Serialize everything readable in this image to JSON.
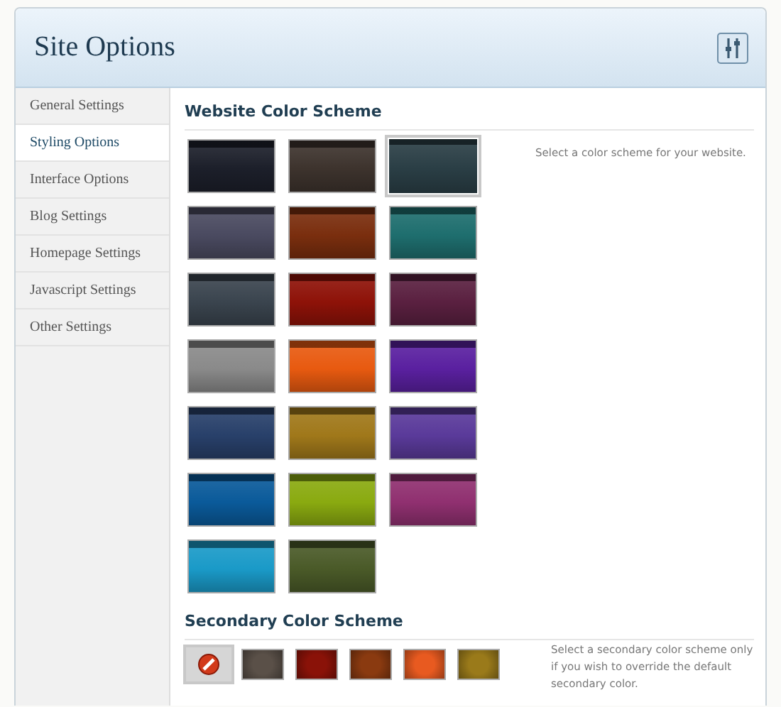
{
  "header": {
    "title": "Site Options"
  },
  "sidebar": {
    "items": [
      {
        "label": "General Settings",
        "selected": false
      },
      {
        "label": "Styling Options",
        "selected": true
      },
      {
        "label": "Interface Options",
        "selected": false
      },
      {
        "label": "Blog Settings",
        "selected": false
      },
      {
        "label": "Homepage Settings",
        "selected": false
      },
      {
        "label": "Javascript Settings",
        "selected": false
      },
      {
        "label": "Other Settings",
        "selected": false
      }
    ]
  },
  "website_color_scheme": {
    "heading": "Website Color Scheme",
    "description": "Select a color scheme for your website.",
    "swatches": [
      {
        "color": "#1c1f2a",
        "selected": false
      },
      {
        "color": "#3d332d",
        "selected": false
      },
      {
        "color": "#2a3e45",
        "selected": true
      },
      {
        "color": "#4a4a60",
        "selected": false
      },
      {
        "color": "#7a2e0e",
        "selected": false
      },
      {
        "color": "#1e6e6e",
        "selected": false
      },
      {
        "color": "#3a444e",
        "selected": false
      },
      {
        "color": "#8e1208",
        "selected": false
      },
      {
        "color": "#5a2040",
        "selected": false
      },
      {
        "color": "#8a8a8a",
        "selected": false
      },
      {
        "color": "#e85a10",
        "selected": false
      },
      {
        "color": "#5a20a0",
        "selected": false
      },
      {
        "color": "#28406a",
        "selected": false
      },
      {
        "color": "#a0781a",
        "selected": false
      },
      {
        "color": "#5a3a9a",
        "selected": false
      },
      {
        "color": "#0a5a9a",
        "selected": false
      },
      {
        "color": "#8aaa10",
        "selected": false
      },
      {
        "color": "#903070",
        "selected": false
      },
      {
        "color": "#1a9ac8",
        "selected": false
      },
      {
        "color": "#4a5a28",
        "selected": false
      }
    ]
  },
  "secondary_color_scheme": {
    "heading": "Secondary Color Scheme",
    "description": "Select a secondary color scheme only if you wish to override the default secondary color.",
    "swatches": [
      {
        "kind": "none",
        "selected": true
      },
      {
        "kind": "color",
        "color": "#5a5048",
        "selected": false
      },
      {
        "kind": "color",
        "color": "#8a1208",
        "selected": false
      },
      {
        "kind": "color",
        "color": "#8a3a10",
        "selected": false
      },
      {
        "kind": "color",
        "color": "#e85a20",
        "selected": false
      },
      {
        "kind": "color",
        "color": "#9a7a1a",
        "selected": false
      }
    ]
  }
}
